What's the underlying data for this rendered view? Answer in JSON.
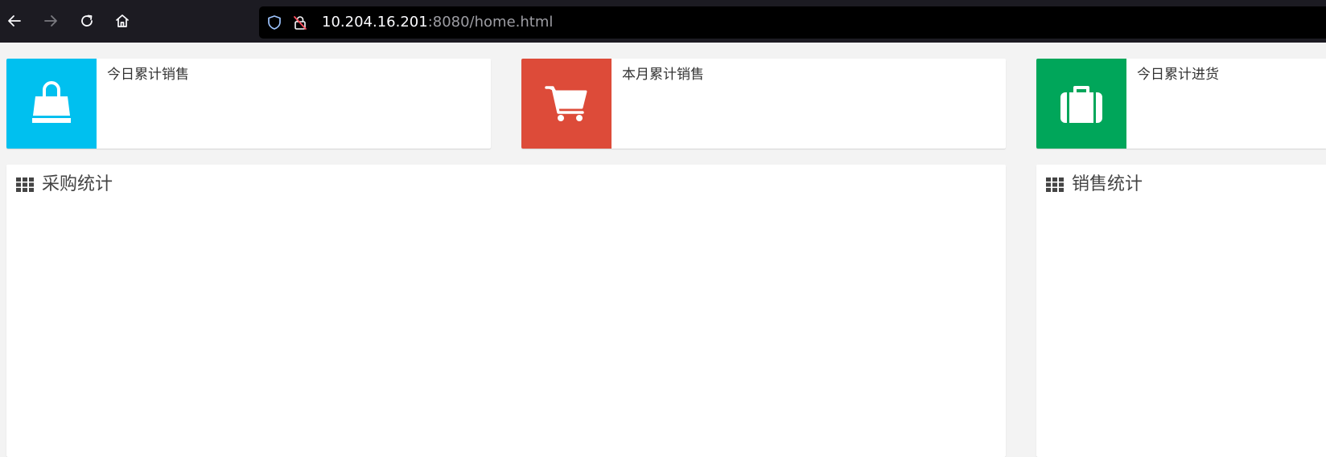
{
  "browser": {
    "url_host": "10.204.16.201",
    "url_rest": ":8080/home.html",
    "icons": {
      "back": "back-arrow-icon",
      "forward": "forward-arrow-icon",
      "reload": "reload-icon",
      "home": "home-icon",
      "tracking": "shield-icon",
      "insecure": "insecure-lock-icon"
    }
  },
  "stats": [
    {
      "label": "今日累计销售",
      "color": "#00c0ef",
      "icon": "shopping-bag-icon"
    },
    {
      "label": "本月累计销售",
      "color": "#dd4b39",
      "icon": "shopping-cart-icon"
    },
    {
      "label": "今日累计进货",
      "color": "#00a65a",
      "icon": "suitcase-icon"
    }
  ],
  "panels": [
    {
      "title": "采购统计",
      "icon": "grid-icon"
    },
    {
      "title": "销售统计",
      "icon": "grid-icon"
    }
  ]
}
